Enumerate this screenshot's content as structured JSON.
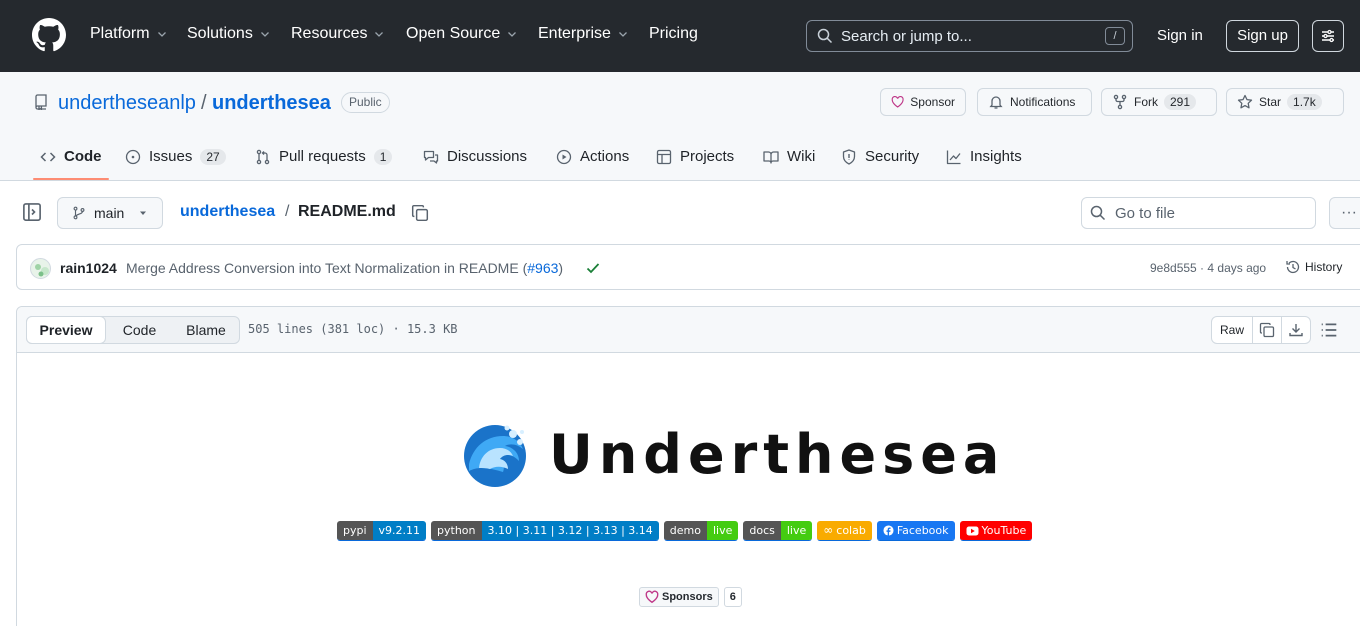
{
  "header": {
    "nav": [
      {
        "label": "Platform",
        "has_menu": true
      },
      {
        "label": "Solutions",
        "has_menu": true
      },
      {
        "label": "Resources",
        "has_menu": true
      },
      {
        "label": "Open Source",
        "has_menu": true
      },
      {
        "label": "Enterprise",
        "has_menu": true
      },
      {
        "label": "Pricing",
        "has_menu": false
      }
    ],
    "search_placeholder": "Search or jump to...",
    "search_shortcut": "/",
    "sign_in": "Sign in",
    "sign_up": "Sign up"
  },
  "repo": {
    "owner": "undertheseanlp",
    "separator": "/",
    "name": "underthesea",
    "visibility": "Public",
    "sponsor_label": "Sponsor",
    "notifications_label": "Notifications",
    "fork_label": "Fork",
    "fork_count": "291",
    "star_label": "Star",
    "star_count": "1.7k"
  },
  "tabs": [
    {
      "label": "Code",
      "icon": "code-icon",
      "count": null,
      "active": true
    },
    {
      "label": "Issues",
      "icon": "issue-icon",
      "count": "27"
    },
    {
      "label": "Pull requests",
      "icon": "pull-request-icon",
      "count": "1"
    },
    {
      "label": "Discussions",
      "icon": "discussion-icon",
      "count": null
    },
    {
      "label": "Actions",
      "icon": "play-icon",
      "count": null
    },
    {
      "label": "Projects",
      "icon": "table-icon",
      "count": null
    },
    {
      "label": "Wiki",
      "icon": "book-icon",
      "count": null
    },
    {
      "label": "Security",
      "icon": "shield-icon",
      "count": null
    },
    {
      "label": "Insights",
      "icon": "graph-icon",
      "count": null
    }
  ],
  "file_nav": {
    "branch": "main",
    "crumb_repo": "underthesea",
    "crumb_sep": "/",
    "crumb_file": "README.md",
    "goto_placeholder": "Go to file",
    "more_label": "···"
  },
  "commit": {
    "author": "rain1024",
    "message_prefix": "Merge Address Conversion into Text Normalization in README (",
    "pr_link": "#963",
    "message_suffix": ")",
    "meta": "9e8d555 · 4 days ago",
    "history_label": "History",
    "status_color": "#1a7f37"
  },
  "file_view": {
    "modes": [
      "Preview",
      "Code",
      "Blame"
    ],
    "active_mode": "Preview",
    "info": "505 lines (381 loc) · 15.3 KB",
    "raw_label": "Raw"
  },
  "readme": {
    "title": "Underthesea",
    "badges": [
      {
        "left": "pypi",
        "right": "v9.2.11",
        "right_color": "#007ec6"
      },
      {
        "left": "python",
        "right": "3.10 | 3.11 | 3.12 | 3.13 | 3.14",
        "right_color": "#007ec6"
      },
      {
        "left": "demo",
        "right": "live",
        "right_color": "#4c1"
      },
      {
        "left": "docs",
        "right": "live",
        "right_color": "#4c1"
      },
      {
        "left": "",
        "right": "colab",
        "right_color": "#f9ab00",
        "icon": "infinity-icon"
      },
      {
        "left": "",
        "right": "Facebook",
        "right_color": "#1877f2",
        "icon": "facebook-icon"
      },
      {
        "left": "",
        "right": "YouTube",
        "right_color": "#ff0000",
        "icon": "youtube-icon"
      }
    ],
    "sponsors_label": "Sponsors",
    "sponsors_count": "6"
  }
}
